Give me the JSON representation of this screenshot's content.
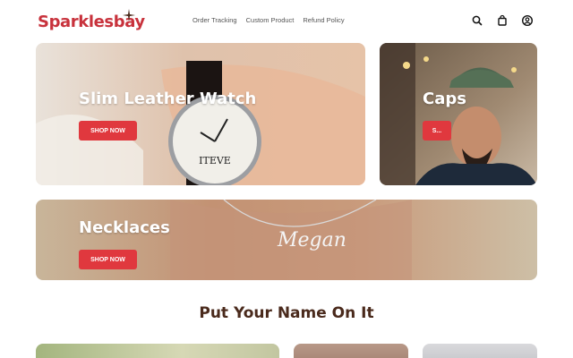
{
  "header": {
    "logo": "Sparklesbay",
    "nav": [
      {
        "label": "Order Tracking"
      },
      {
        "label": "Custom Product"
      },
      {
        "label": "Refund Policy"
      }
    ],
    "icons": [
      "search-icon",
      "bag-icon",
      "account-icon"
    ]
  },
  "banners": [
    {
      "title": "Slim Leather Watch",
      "button": "SHOP NOW"
    },
    {
      "title": "Caps",
      "button": "S..."
    },
    {
      "title": "Necklaces",
      "button": "SHOP NOW"
    }
  ],
  "banner_art": {
    "watch_name": "ITEVE",
    "necklace_name": "Megan"
  },
  "section": {
    "title": "Put Your Name On It"
  },
  "colors": {
    "brand": "#c8323c",
    "button": "#e0383e",
    "heading": "#4a2a1c"
  }
}
